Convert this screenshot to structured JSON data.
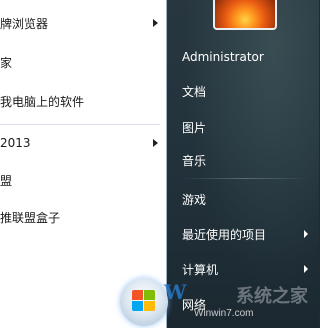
{
  "left_programs": [
    {
      "label": "牌浏览器",
      "has_submenu": true
    },
    {
      "label": "家",
      "has_submenu": false
    },
    {
      "label": "我电脑上的软件",
      "has_submenu": false
    },
    {
      "label": "2013",
      "has_submenu": true
    },
    {
      "label": "盟",
      "has_submenu": false
    },
    {
      "label": "推联盟盒子",
      "has_submenu": false
    }
  ],
  "right_menu": {
    "user_name": "Administrator",
    "items": [
      {
        "label": "文档",
        "has_submenu": false
      },
      {
        "label": "图片",
        "has_submenu": false
      },
      {
        "label": "音乐",
        "has_submenu": false
      },
      {
        "label": "游戏",
        "has_submenu": false
      },
      {
        "label": "最近使用的项目",
        "has_submenu": true
      },
      {
        "label": "计算机",
        "has_submenu": true
      },
      {
        "label": "网络",
        "has_submenu": false
      }
    ]
  },
  "watermark": {
    "logo": "W",
    "title": "系统之家",
    "url": "Winwin7.com"
  },
  "colors": {
    "left_bg": "#ffffff",
    "right_bg": "#24343d",
    "accent_orb": "#a8bfd2"
  }
}
